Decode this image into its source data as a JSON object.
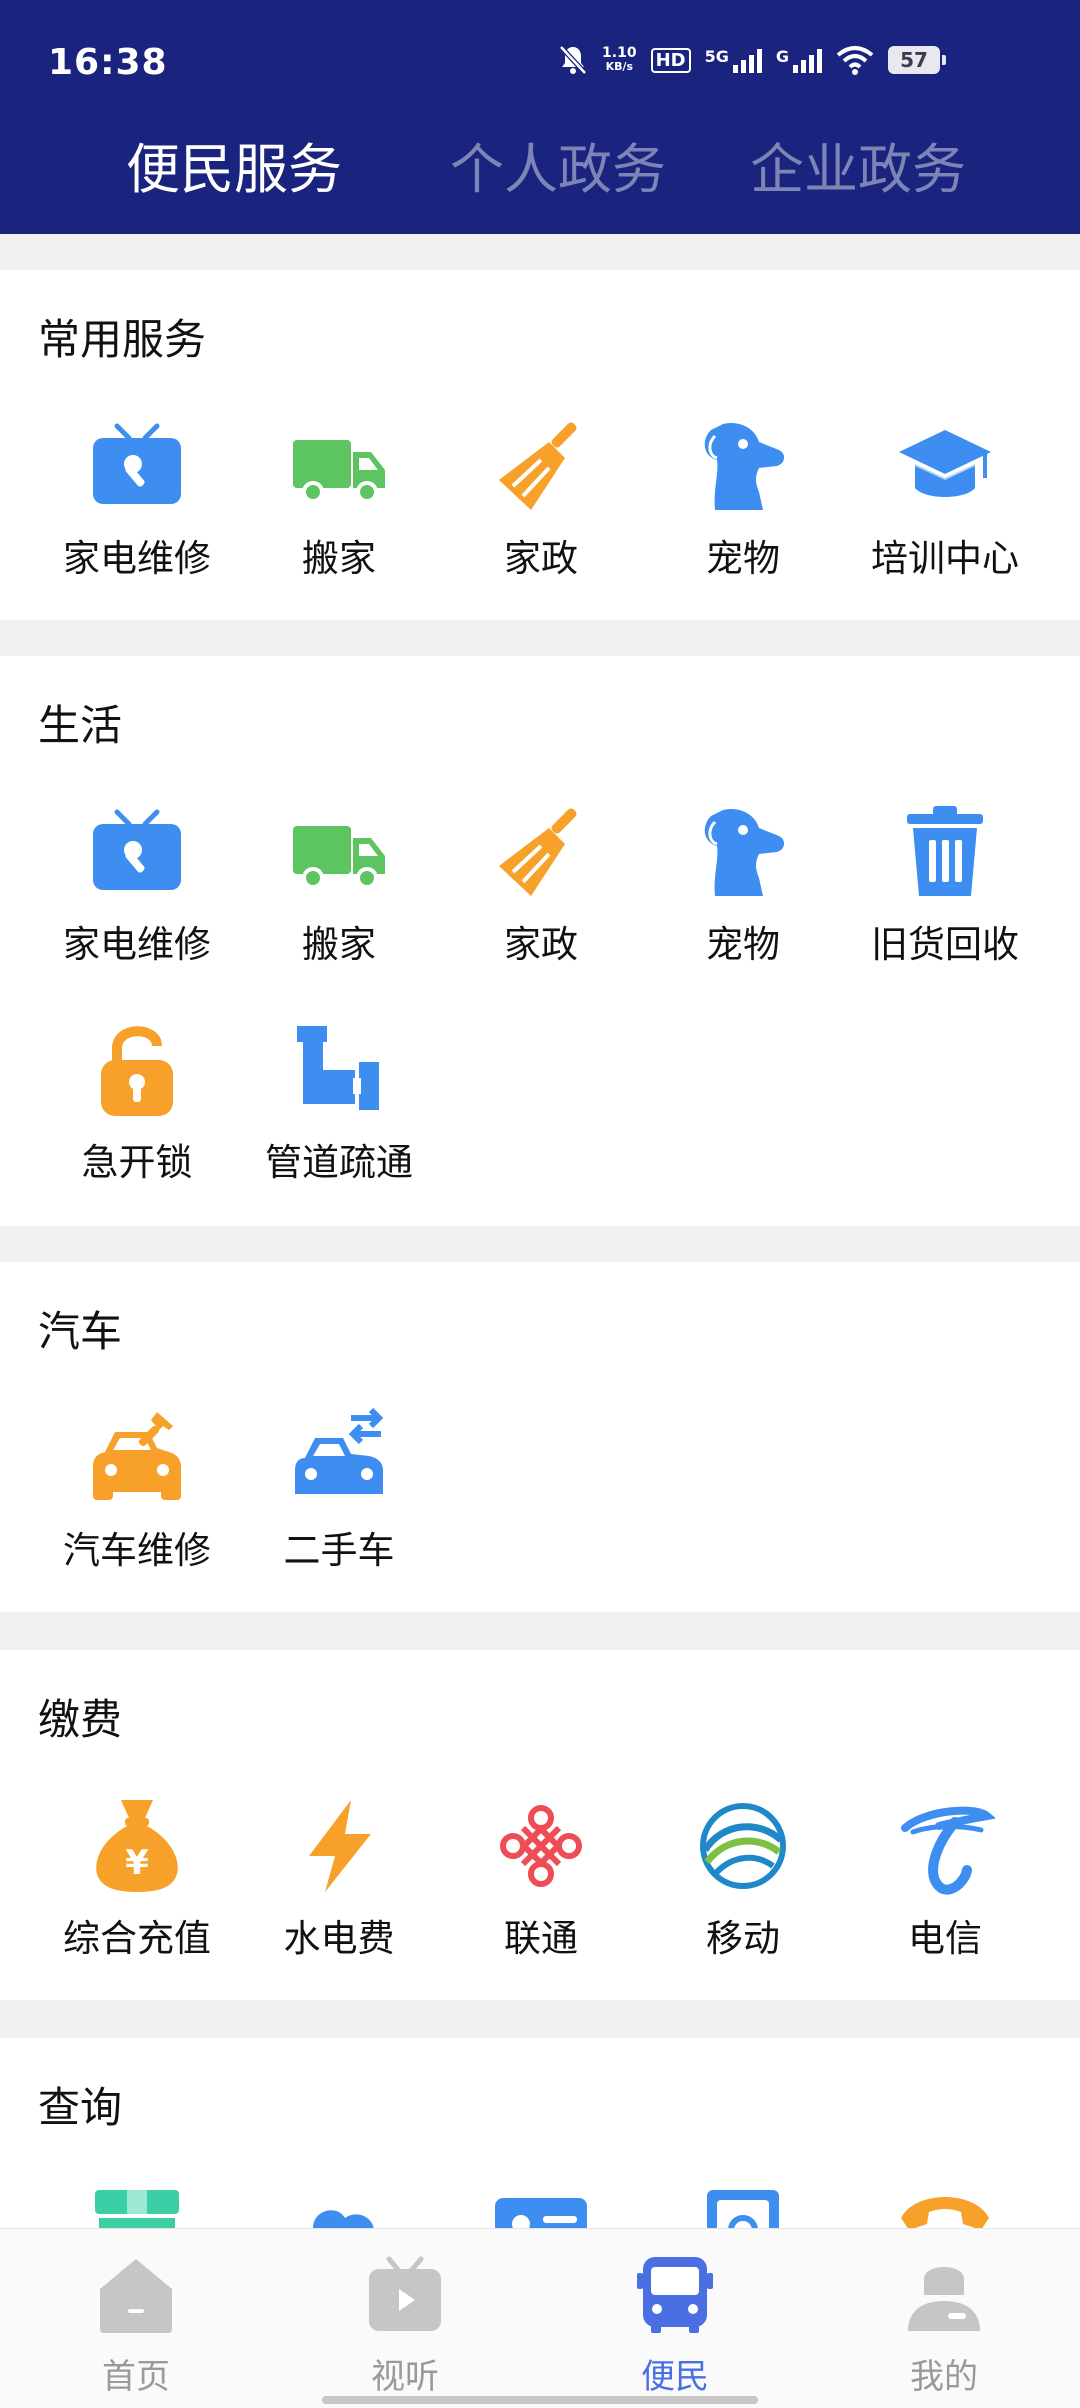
{
  "status_bar": {
    "time": "16:38",
    "net_speed_top": "1.10",
    "net_speed_bottom": "KB/s",
    "hd_label": "HD",
    "sig1_label": "5G",
    "sig2_label": "G",
    "battery": "57"
  },
  "top_tabs": [
    {
      "label": "便民服务",
      "active": true
    },
    {
      "label": "个人政务",
      "active": false
    },
    {
      "label": "企业政务",
      "active": false
    }
  ],
  "sections": [
    {
      "title": "常用服务",
      "items": [
        {
          "label": "家电维修",
          "icon": "tv-repair-icon"
        },
        {
          "label": "搬家",
          "icon": "truck-icon"
        },
        {
          "label": "家政",
          "icon": "broom-icon"
        },
        {
          "label": "宠物",
          "icon": "dog-icon"
        },
        {
          "label": "培训中心",
          "icon": "graduation-cap-icon"
        }
      ]
    },
    {
      "title": "生活",
      "items": [
        {
          "label": "家电维修",
          "icon": "tv-repair-icon"
        },
        {
          "label": "搬家",
          "icon": "truck-icon"
        },
        {
          "label": "家政",
          "icon": "broom-icon"
        },
        {
          "label": "宠物",
          "icon": "dog-icon"
        },
        {
          "label": "旧货回收",
          "icon": "trash-bin-icon"
        },
        {
          "label": "急开锁",
          "icon": "unlock-icon"
        },
        {
          "label": "管道疏通",
          "icon": "pipe-icon"
        }
      ]
    },
    {
      "title": "汽车",
      "items": [
        {
          "label": "汽车维修",
          "icon": "car-repair-icon"
        },
        {
          "label": "二手车",
          "icon": "car-exchange-icon"
        }
      ]
    },
    {
      "title": "缴费",
      "items": [
        {
          "label": "综合充值",
          "icon": "money-bag-icon"
        },
        {
          "label": "水电费",
          "icon": "lightning-icon"
        },
        {
          "label": "联通",
          "icon": "unicom-logo-icon"
        },
        {
          "label": "移动",
          "icon": "mobile-logo-icon"
        },
        {
          "label": "电信",
          "icon": "telecom-logo-icon"
        }
      ]
    },
    {
      "title": "查询",
      "items": [
        {
          "label": "",
          "icon": "package-icon"
        },
        {
          "label": "",
          "icon": "cloud-icon"
        },
        {
          "label": "",
          "icon": "id-card-icon"
        },
        {
          "label": "",
          "icon": "safe-icon"
        },
        {
          "label": "",
          "icon": "telephone-icon"
        }
      ]
    }
  ],
  "bottom_nav": [
    {
      "label": "首页",
      "icon": "home-icon",
      "active": false
    },
    {
      "label": "视听",
      "icon": "tv-play-icon",
      "active": false
    },
    {
      "label": "便民",
      "icon": "bus-icon",
      "active": true
    },
    {
      "label": "我的",
      "icon": "person-icon",
      "active": false
    }
  ],
  "colors": {
    "header_bg": "#1a237e",
    "blue": "#3d8ef0",
    "green": "#5cc461",
    "orange": "#f7a12a",
    "active_nav": "#4a6fe3"
  }
}
